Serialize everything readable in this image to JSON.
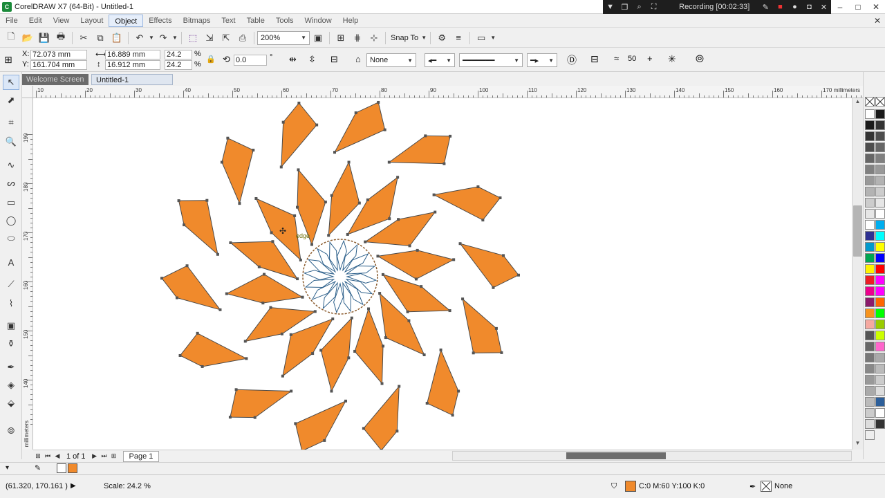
{
  "window": {
    "title": "CorelDRAW X7 (64-Bit) - Untitled-1",
    "app_icon": "coreldraw-icon",
    "recording_text": "Recording [00:02:33]",
    "controls": [
      "–",
      "□",
      "✕"
    ]
  },
  "menu": {
    "items": [
      "File",
      "Edit",
      "View",
      "Layout",
      "Object",
      "Effects",
      "Bitmaps",
      "Text",
      "Table",
      "Tools",
      "Window",
      "Help"
    ],
    "active": "Object"
  },
  "toolbar": {
    "zoom": "200%",
    "snap_to": "Snap To"
  },
  "propbar": {
    "x_label": "X:",
    "x_value": "72.073 mm",
    "y_label": "Y:",
    "y_value": "161.704 mm",
    "w_value": "16.889 mm",
    "h_value": "16.912 mm",
    "scale_x": "24.2",
    "scale_y": "24.2",
    "percent": "%",
    "rotation": "0.0",
    "degree": "°",
    "wrap": "None",
    "smoothing": "50"
  },
  "tabs": {
    "inactive": "Welcome Screen",
    "active": "Untitled-1"
  },
  "ruler": {
    "h_labels": [
      "10",
      "20",
      "30",
      "40",
      "50",
      "60",
      "70",
      "80",
      "90",
      "100",
      "110",
      "120",
      "130",
      "140",
      "150",
      "160",
      "170"
    ],
    "v_labels": [
      "190",
      "180",
      "170",
      "160",
      "150",
      "140"
    ],
    "units": "millimeters"
  },
  "canvas": {
    "node_label": "edge",
    "fill_color": "#F08A2C",
    "outline_color": "#4a4a4a"
  },
  "pagenav": {
    "page_count": "1 of 1",
    "page_tab": "Page 1"
  },
  "status": {
    "coords": "(61.320, 170.161 )",
    "scale": "Scale: 24.2 %",
    "fill_info": "C:0 M:60 Y:100 K:0",
    "outline_info": "None"
  },
  "palette": {
    "colors": [
      "#ffffff",
      "#1a1a1a",
      "#333333",
      "#4d4d4d",
      "#666666",
      "#808080",
      "#999999",
      "#b3b3b3",
      "#cccccc",
      "#e6e6e6",
      "#ffffff",
      "#2e3192",
      "#0099cc",
      "#00a651",
      "#fff200",
      "#ed1c24",
      "#ec008c",
      "#8b1a6b",
      "#f7941d",
      "#f5a9a0",
      "#555555",
      "#666666",
      "#777777",
      "#888888",
      "#999999",
      "#aaaaaa",
      "#bbbbbb",
      "#cccccc",
      "#dddddd",
      "#eeeeee"
    ],
    "colors2": [
      "#1a1a1a",
      "#333333",
      "#4d4d4d",
      "#666666",
      "#808080",
      "#999999",
      "#b3b3b3",
      "#cccccc",
      "#e6e6e6",
      "#ffffff",
      "#00aeef",
      "#00ffff",
      "#ffff00",
      "#0000ff",
      "#ff0000",
      "#ff00ff",
      "#ff00ff",
      "#ff6600",
      "#00ff00",
      "#99cc00",
      "#ccff00",
      "#ff66cc",
      "#aaaaaa",
      "#bbbbbb",
      "#cccccc",
      "#dddddd",
      "#2d5f9a",
      "#ffffff",
      "#333333"
    ]
  }
}
